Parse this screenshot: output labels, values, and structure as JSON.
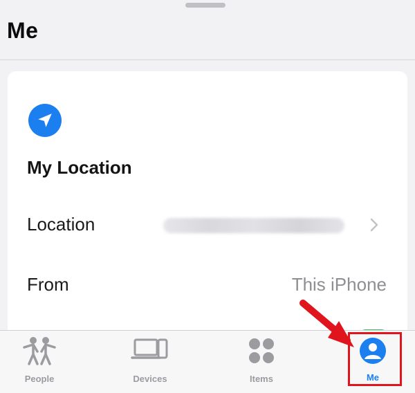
{
  "header": {
    "title": "Me"
  },
  "my_location": {
    "heading": "My Location",
    "icon": "location-arrow-icon",
    "accent": "#1b7ff0",
    "rows": [
      {
        "label": "Location",
        "value_redacted": true
      },
      {
        "label": "From",
        "value": "This iPhone"
      }
    ]
  },
  "tabbar": {
    "tabs": [
      {
        "label": "People",
        "icon": "people-icon"
      },
      {
        "label": "Devices",
        "icon": "devices-icon"
      },
      {
        "label": "Items",
        "icon": "items-icon"
      },
      {
        "label": "Me",
        "icon": "me-icon",
        "active": true
      }
    ]
  },
  "annotation": {
    "color": "#e0141c"
  }
}
